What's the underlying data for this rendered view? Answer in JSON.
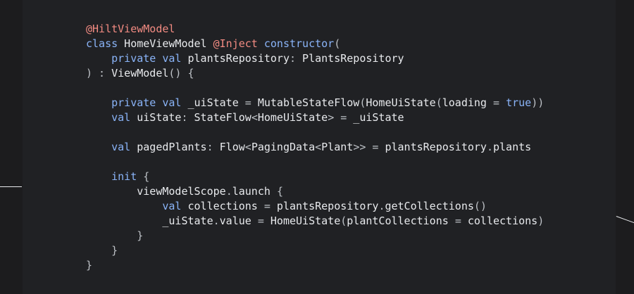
{
  "colors": {
    "background": "#1c1c1e",
    "panel": "#202124",
    "text": "#e8eaed",
    "keyword": "#8ab4f8",
    "annotation": "#f28b82",
    "punctuation": "#bdc1c6"
  },
  "code": {
    "lines": [
      [
        {
          "t": "@HiltViewModel",
          "k": "anno"
        }
      ],
      [
        {
          "t": "class",
          "k": "kw"
        },
        {
          "t": " HomeViewModel ",
          "k": "id"
        },
        {
          "t": "@Inject",
          "k": "anno"
        },
        {
          "t": " ",
          "k": "id"
        },
        {
          "t": "constructor",
          "k": "kw"
        },
        {
          "t": "(",
          "k": "punc"
        }
      ],
      [
        {
          "t": "    ",
          "k": "id"
        },
        {
          "t": "private val",
          "k": "kw"
        },
        {
          "t": " plantsRepository",
          "k": "id"
        },
        {
          "t": ":",
          "k": "punc"
        },
        {
          "t": " PlantsRepository",
          "k": "id"
        }
      ],
      [
        {
          "t": ") : ",
          "k": "punc"
        },
        {
          "t": "ViewModel",
          "k": "id"
        },
        {
          "t": "() {",
          "k": "punc"
        }
      ],
      [],
      [
        {
          "t": "    ",
          "k": "id"
        },
        {
          "t": "private val",
          "k": "kw"
        },
        {
          "t": " _uiState ",
          "k": "id"
        },
        {
          "t": "=",
          "k": "punc"
        },
        {
          "t": " MutableStateFlow",
          "k": "id"
        },
        {
          "t": "(",
          "k": "punc"
        },
        {
          "t": "HomeUiState",
          "k": "id"
        },
        {
          "t": "(",
          "k": "punc"
        },
        {
          "t": "loading ",
          "k": "id"
        },
        {
          "t": "=",
          "k": "punc"
        },
        {
          "t": " ",
          "k": "id"
        },
        {
          "t": "true",
          "k": "kw"
        },
        {
          "t": "))",
          "k": "punc"
        }
      ],
      [
        {
          "t": "    ",
          "k": "id"
        },
        {
          "t": "val",
          "k": "kw"
        },
        {
          "t": " uiState",
          "k": "id"
        },
        {
          "t": ":",
          "k": "punc"
        },
        {
          "t": " StateFlow",
          "k": "id"
        },
        {
          "t": "<",
          "k": "punc"
        },
        {
          "t": "HomeUiState",
          "k": "id"
        },
        {
          "t": ">",
          "k": "punc"
        },
        {
          "t": " ",
          "k": "id"
        },
        {
          "t": "=",
          "k": "punc"
        },
        {
          "t": " _uiState",
          "k": "id"
        }
      ],
      [],
      [
        {
          "t": "    ",
          "k": "id"
        },
        {
          "t": "val",
          "k": "kw"
        },
        {
          "t": " pagedPlants",
          "k": "id"
        },
        {
          "t": ":",
          "k": "punc"
        },
        {
          "t": " Flow",
          "k": "id"
        },
        {
          "t": "<",
          "k": "punc"
        },
        {
          "t": "PagingData",
          "k": "id"
        },
        {
          "t": "<",
          "k": "punc"
        },
        {
          "t": "Plant",
          "k": "id"
        },
        {
          "t": ">>",
          "k": "punc"
        },
        {
          "t": " ",
          "k": "id"
        },
        {
          "t": "=",
          "k": "punc"
        },
        {
          "t": " plantsRepository",
          "k": "id"
        },
        {
          "t": ".",
          "k": "punc"
        },
        {
          "t": "plants",
          "k": "id"
        }
      ],
      [],
      [
        {
          "t": "    ",
          "k": "id"
        },
        {
          "t": "init",
          "k": "kw"
        },
        {
          "t": " {",
          "k": "punc"
        }
      ],
      [
        {
          "t": "        viewModelScope",
          "k": "id"
        },
        {
          "t": ".",
          "k": "punc"
        },
        {
          "t": "launch ",
          "k": "id"
        },
        {
          "t": "{",
          "k": "punc"
        }
      ],
      [
        {
          "t": "            ",
          "k": "id"
        },
        {
          "t": "val",
          "k": "kw"
        },
        {
          "t": " collections ",
          "k": "id"
        },
        {
          "t": "=",
          "k": "punc"
        },
        {
          "t": " plantsRepository",
          "k": "id"
        },
        {
          "t": ".",
          "k": "punc"
        },
        {
          "t": "getCollections",
          "k": "id"
        },
        {
          "t": "()",
          "k": "punc"
        }
      ],
      [
        {
          "t": "            _uiState",
          "k": "id"
        },
        {
          "t": ".",
          "k": "punc"
        },
        {
          "t": "value ",
          "k": "id"
        },
        {
          "t": "=",
          "k": "punc"
        },
        {
          "t": " HomeUiState",
          "k": "id"
        },
        {
          "t": "(",
          "k": "punc"
        },
        {
          "t": "plantCollections ",
          "k": "id"
        },
        {
          "t": "=",
          "k": "punc"
        },
        {
          "t": " collections",
          "k": "id"
        },
        {
          "t": ")",
          "k": "punc"
        }
      ],
      [
        {
          "t": "        }",
          "k": "punc"
        }
      ],
      [
        {
          "t": "    }",
          "k": "punc"
        }
      ],
      [
        {
          "t": "}",
          "k": "punc"
        }
      ]
    ]
  }
}
